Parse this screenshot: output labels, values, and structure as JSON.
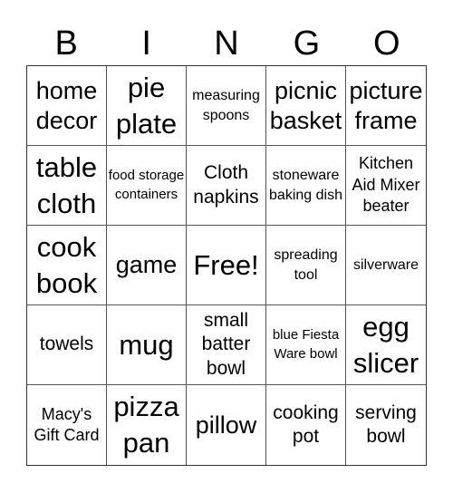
{
  "header": [
    "B",
    "I",
    "N",
    "G",
    "O"
  ],
  "cells": [
    [
      "home decor",
      "pie plate",
      "measuring spoons",
      "picnic basket",
      "picture frame"
    ],
    [
      "table cloth",
      "food storage containers",
      "Cloth napkins",
      "stoneware baking dish",
      "Kitchen Aid Mixer beater"
    ],
    [
      "cook book",
      "game",
      "Free!",
      "spreading tool",
      "silverware"
    ],
    [
      "towels",
      "mug",
      "small batter bowl",
      "blue Fiesta Ware bowl",
      "egg slicer"
    ],
    [
      "Macy's Gift Card",
      "pizza pan",
      "pillow",
      "cooking pot",
      "serving bowl"
    ]
  ]
}
